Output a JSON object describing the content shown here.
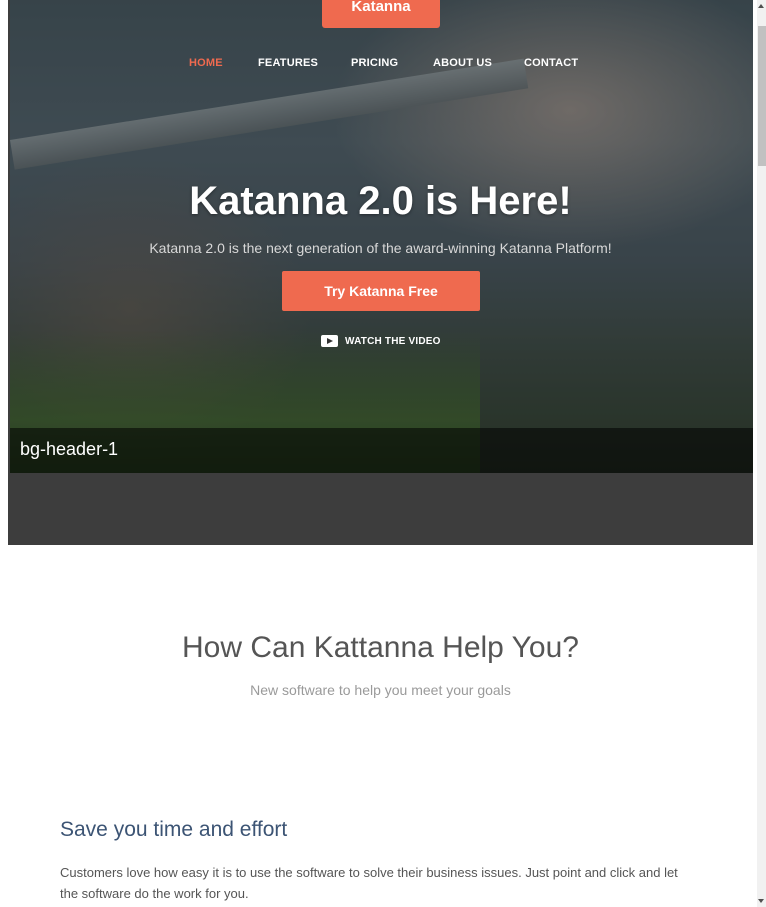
{
  "header": {
    "logo_text": "Katanna",
    "nav": [
      {
        "label": "HOME",
        "active": true
      },
      {
        "label": "FEATURES",
        "active": false
      },
      {
        "label": "PRICING",
        "active": false
      },
      {
        "label": "ABOUT US",
        "active": false
      },
      {
        "label": "CONTACT",
        "active": false
      }
    ]
  },
  "hero": {
    "title": "Katanna 2.0 is Here!",
    "subtitle": "Katanna 2.0 is the next generation of the award-winning Katanna Platform!",
    "cta_label": "Try Katanna Free",
    "watch_label": "WATCH THE VIDEO",
    "watch_icon": "play-icon",
    "image_caption": "bg-header-1"
  },
  "section": {
    "title": "How Can Kattanna Help You?",
    "subtitle": "New software to help you meet your goals"
  },
  "feature": {
    "title": "Save you time and effort",
    "text": "Customers love how easy it is to use the software to solve their business issues. Just point and click and let the software do the work for you."
  },
  "colors": {
    "accent": "#ef6a4f",
    "feature_title": "#3c5474",
    "hero_bottom": "#3d3d3d"
  }
}
